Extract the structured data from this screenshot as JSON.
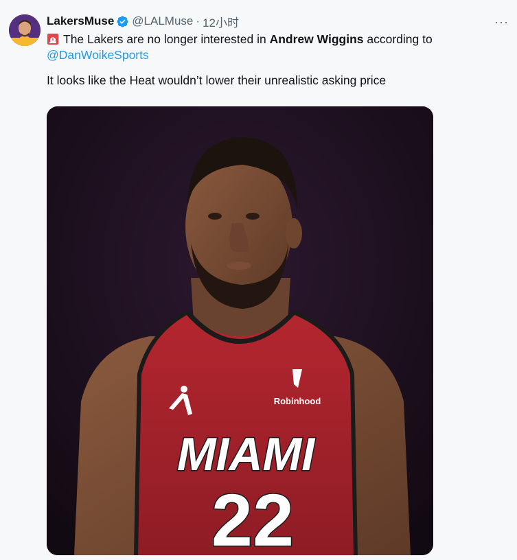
{
  "tweet": {
    "display_name": "LakersMuse",
    "handle": "@LALMuse",
    "separator": "·",
    "time": "12小时",
    "more_label": "···",
    "line1_pre": "The Lakers are no longer interested in ",
    "line1_bold": "Andrew Wiggins",
    "line1_post": " according to",
    "mention": "@DanWoikeSports",
    "line2": "It looks like the Heat wouldn’t lower their unrealistic asking price"
  },
  "media": {
    "jersey_team": "MIAMI",
    "jersey_number": "22",
    "sponsor": "Robinhood"
  },
  "colors": {
    "accent": "#1d9bf0",
    "text": "#0f1419",
    "secondary": "#536471",
    "jersey_red": "#a3202a"
  }
}
